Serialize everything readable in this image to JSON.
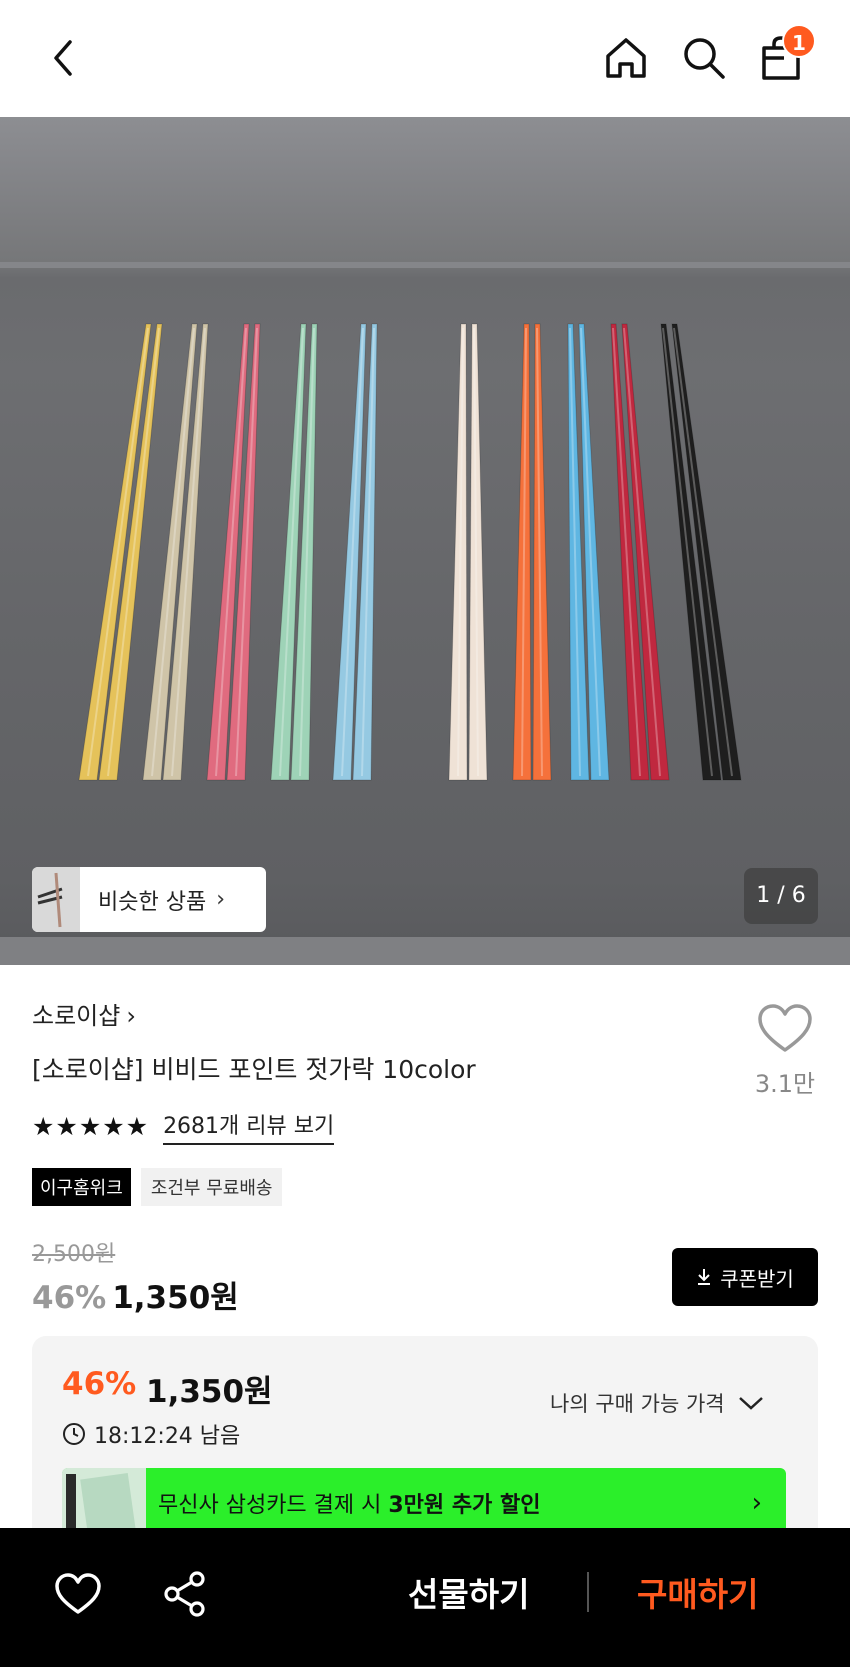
{
  "header": {
    "back_icon": "chevron-left-icon",
    "home_icon": "home-icon",
    "search_icon": "search-icon",
    "bag_icon": "shopping-bag-icon",
    "cart_count": "1"
  },
  "hero": {
    "similar_label": "비슷한 상품",
    "image_counter": "1 / 6",
    "chopstick_colors": [
      "#e5c25a",
      "#cfc4a8",
      "#e06b7f",
      "#9ed3b7",
      "#95c9e2",
      "#efe2d6",
      "#f5713b",
      "#5fb6e2",
      "#c0283f",
      "#1e1e1e"
    ]
  },
  "product": {
    "brand": "소로이샵",
    "title": "[소로이샵] 비비드 포인트 젓가락 10color",
    "like_count": "3.1만",
    "review_link": "2681개 리뷰 보기",
    "rating_stars": 5,
    "tags": [
      "이구홈위크",
      "조건부 무료배송"
    ],
    "original_price": "2,500원",
    "discount_percent": "46%",
    "sale_price": "1,350원",
    "coupon_button": "쿠폰받기"
  },
  "pricebox": {
    "discount_percent": "46%",
    "price": "1,350원",
    "timer": "18:12:24 남음",
    "my_price_label": "나의 구매 가능 가격",
    "promo_text_1": "무신사 삼성카드 결제 시 ",
    "promo_text_2": "3만원 추가 할인"
  },
  "bottom": {
    "gift_label": "선물하기",
    "buy_label": "구매하기"
  },
  "colors": {
    "accent": "#ff5a1f",
    "promo": "#2bef2a"
  }
}
